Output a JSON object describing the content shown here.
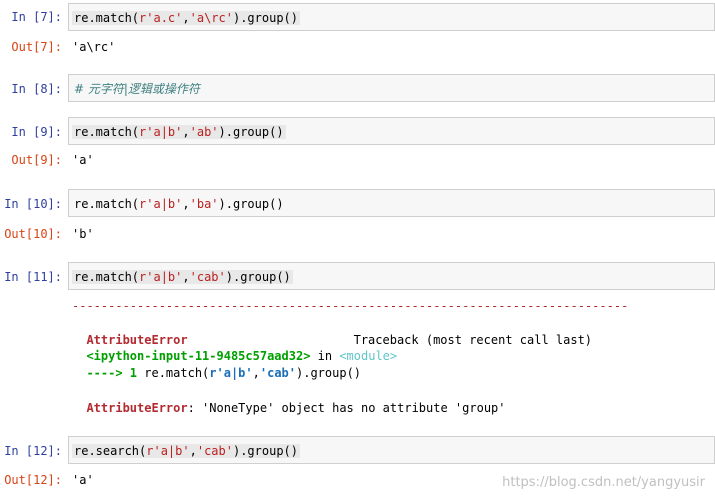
{
  "cells": [
    {
      "in_prompt": "In  [7]:",
      "code": [
        "re.match(",
        "r'a.c'",
        ",",
        "'a\\rc'",
        ").group()"
      ],
      "out_prompt": "Out[7]:",
      "output": "'a\\rc'"
    },
    {
      "in_prompt": "In  [8]:",
      "comment": "# 元字符|逻辑或操作符"
    },
    {
      "in_prompt": "In  [9]:",
      "code": [
        "re.match(",
        "r'a|b'",
        ",",
        "'ab'",
        ").group()"
      ],
      "out_prompt": "Out[9]:",
      "output": "'a'"
    },
    {
      "in_prompt": "In  [10]:",
      "code": [
        "re.match(",
        "r'a|b'",
        ",",
        "'ba'",
        ").group()"
      ],
      "out_prompt": "Out[10]:",
      "output": "'b'"
    },
    {
      "in_prompt": "In  [11]:",
      "code": [
        "re.match(",
        "r'a|b'",
        ",",
        "'cab'",
        ").group()"
      ]
    },
    {
      "in_prompt": "In  [12]:",
      "code": [
        "re.search(",
        "r'a|b'",
        ",",
        "'cab'",
        ").group()"
      ],
      "out_prompt": "Out[12]:",
      "output": "'a'"
    }
  ],
  "traceback": {
    "dashes": "-----------------------------------------------------------------------------",
    "error_name": "AttributeError",
    "traceback_label": "Traceback (most recent call last)",
    "input_ref": "<ipython-input-11-9485c57aad32>",
    "in_word": " in ",
    "module": "<module>",
    "arrow": "----> 1 ",
    "arrow_code_a": "re.match(",
    "arrow_code_str1": "r'a|b'",
    "arrow_code_comma": ",",
    "arrow_code_str2": "'cab'",
    "arrow_code_end": ").group()",
    "error_msg_name": "AttributeError",
    "error_msg": ": 'NoneType' object has no attribute 'group'"
  },
  "watermark": "https://blog.csdn.net/yangyusir"
}
